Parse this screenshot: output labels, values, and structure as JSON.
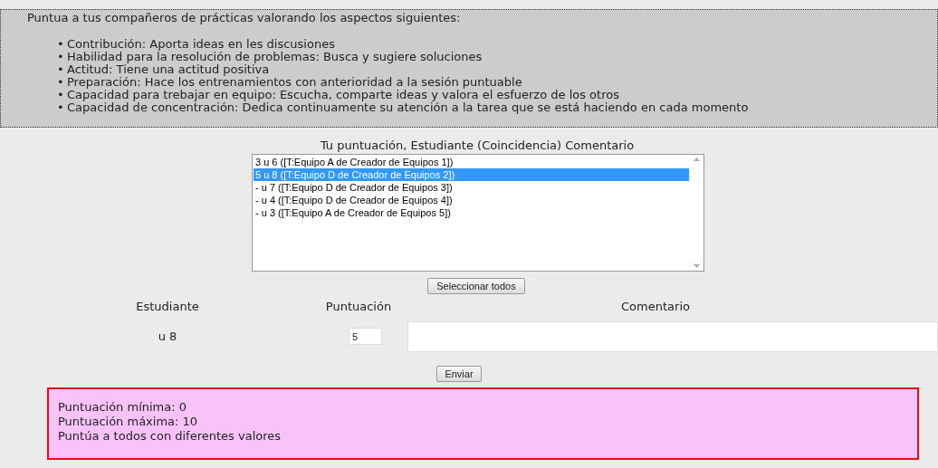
{
  "instructions": {
    "intro": "Puntua a tus compañeros de prácticas valorando los aspectos siguientes:",
    "marker": "•",
    "items": [
      "Contribución: Aporta ideas en les discusiones",
      "Habilidad para la resolución de problemas: Busca y sugiere soluciones",
      "Actitud: Tiene una actitud positiva",
      "Preparación: Hace los entrenamientos con anterioridad a la sesión puntuable",
      "Capacidad para trebajar en equipo: Escucha, comparte ideas y valora el esfuerzo de los otros",
      "Capacidad de concentración: Dedica continuamente su atención a la tarea que se está haciendo en cada momento"
    ]
  },
  "list_title": "Tu puntuación, Estudiante (Coincidencia) Comentario",
  "options": [
    {
      "label": "3 u 6 ([T:Equipo A de Creador de Equipos 1])",
      "selected": false
    },
    {
      "label": "5 u 8 ([T:Equipo D de Creador de Equipos 2])",
      "selected": true
    },
    {
      "label": "- u 7 ([T:Equipo D de Creador de Equipos 3])",
      "selected": false
    },
    {
      "label": "- u 4 ([T:Equipo D de Creador de Equipos 4])",
      "selected": false
    },
    {
      "label": "- u 3 ([T:Equipo A de Creador de Equipos 5])",
      "selected": false
    }
  ],
  "select_all_button": "Seleccionar todos",
  "form": {
    "columns": [
      "Estudiante",
      "Puntuación",
      "Comentario"
    ],
    "student": "u 8",
    "score": "5"
  },
  "submit_button": "Enviar",
  "notice": [
    "Puntuación mínima: 0",
    "Puntuación máxima: 10",
    "Puntúa a todos con diferentes valores"
  ]
}
